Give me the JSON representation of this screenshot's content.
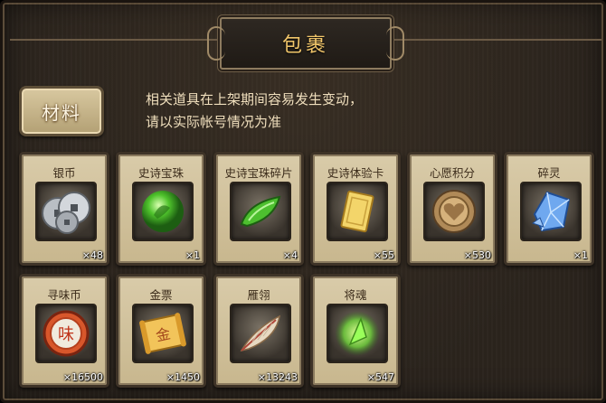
{
  "header": {
    "title": "包裹"
  },
  "tabs": {
    "materials": "材料"
  },
  "notice": {
    "line1": "相关道具在上架期间容易发生变动，",
    "line2": "请以实际帐号情况为准"
  },
  "items": [
    {
      "name": "银币",
      "count": "×48",
      "icon": "silver-coins-icon"
    },
    {
      "name": "史诗宝珠",
      "count": "×1",
      "icon": "green-orb-icon"
    },
    {
      "name": "史诗宝珠碎片",
      "count": "×4",
      "icon": "green-shard-icon"
    },
    {
      "name": "史诗体验卡",
      "count": "×55",
      "icon": "gold-card-icon"
    },
    {
      "name": "心愿积分",
      "count": "×530",
      "icon": "heart-coin-icon"
    },
    {
      "name": "碎灵",
      "count": "×1",
      "icon": "blue-crystal-icon"
    },
    {
      "name": "寻味币",
      "count": "×16500",
      "icon": "flavor-coin-icon"
    },
    {
      "name": "金票",
      "count": "×1450",
      "icon": "gold-ticket-icon"
    },
    {
      "name": "雁翎",
      "count": "×13243",
      "icon": "feather-icon"
    },
    {
      "name": "将魂",
      "count": "×547",
      "icon": "general-soul-icon"
    }
  ]
}
